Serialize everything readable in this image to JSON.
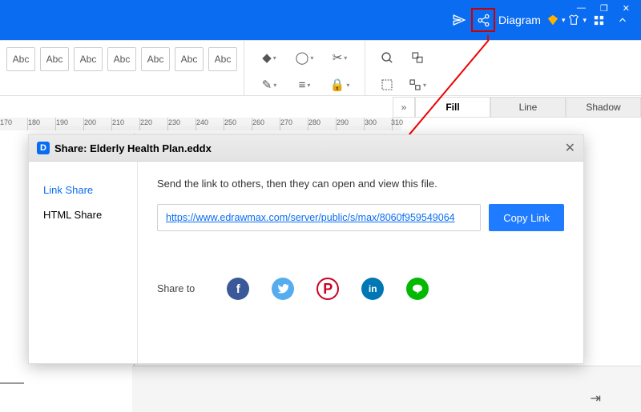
{
  "window": {
    "minimize": "—",
    "maximize": "❐",
    "close": "✕"
  },
  "titlebar": {
    "label": "Diagram",
    "send_icon": "send-icon",
    "share_icon": "share-icon",
    "diamond_icon": "diamond-icon",
    "shirt_icon": "shirt-icon",
    "grid_icon": "apps-icon",
    "collapse_icon": "collapse-icon"
  },
  "styles": [
    "Abc",
    "Abc",
    "Abc",
    "Abc",
    "Abc",
    "Abc",
    "Abc"
  ],
  "ruler_ticks": [
    170,
    180,
    190,
    200,
    210,
    220,
    230,
    240,
    250,
    260,
    270,
    280,
    290,
    300,
    310
  ],
  "tabs": {
    "fill": "Fill",
    "line": "Line",
    "shadow": "Shadow"
  },
  "dialog": {
    "title_prefix": "Share: ",
    "filename": "Elderly Health Plan.eddx",
    "close": "✕",
    "side": {
      "link": "Link Share",
      "html": "HTML Share"
    },
    "instruction": "Send the link to others, then they can open and view this file.",
    "url": "https://www.edrawmax.com/server/public/s/max/8060f959549064",
    "copy": "Copy Link",
    "share_to": "Share to",
    "socials": {
      "facebook": "f",
      "twitter": "t",
      "pinterest": "P",
      "linkedin": "in",
      "line": "●"
    }
  }
}
